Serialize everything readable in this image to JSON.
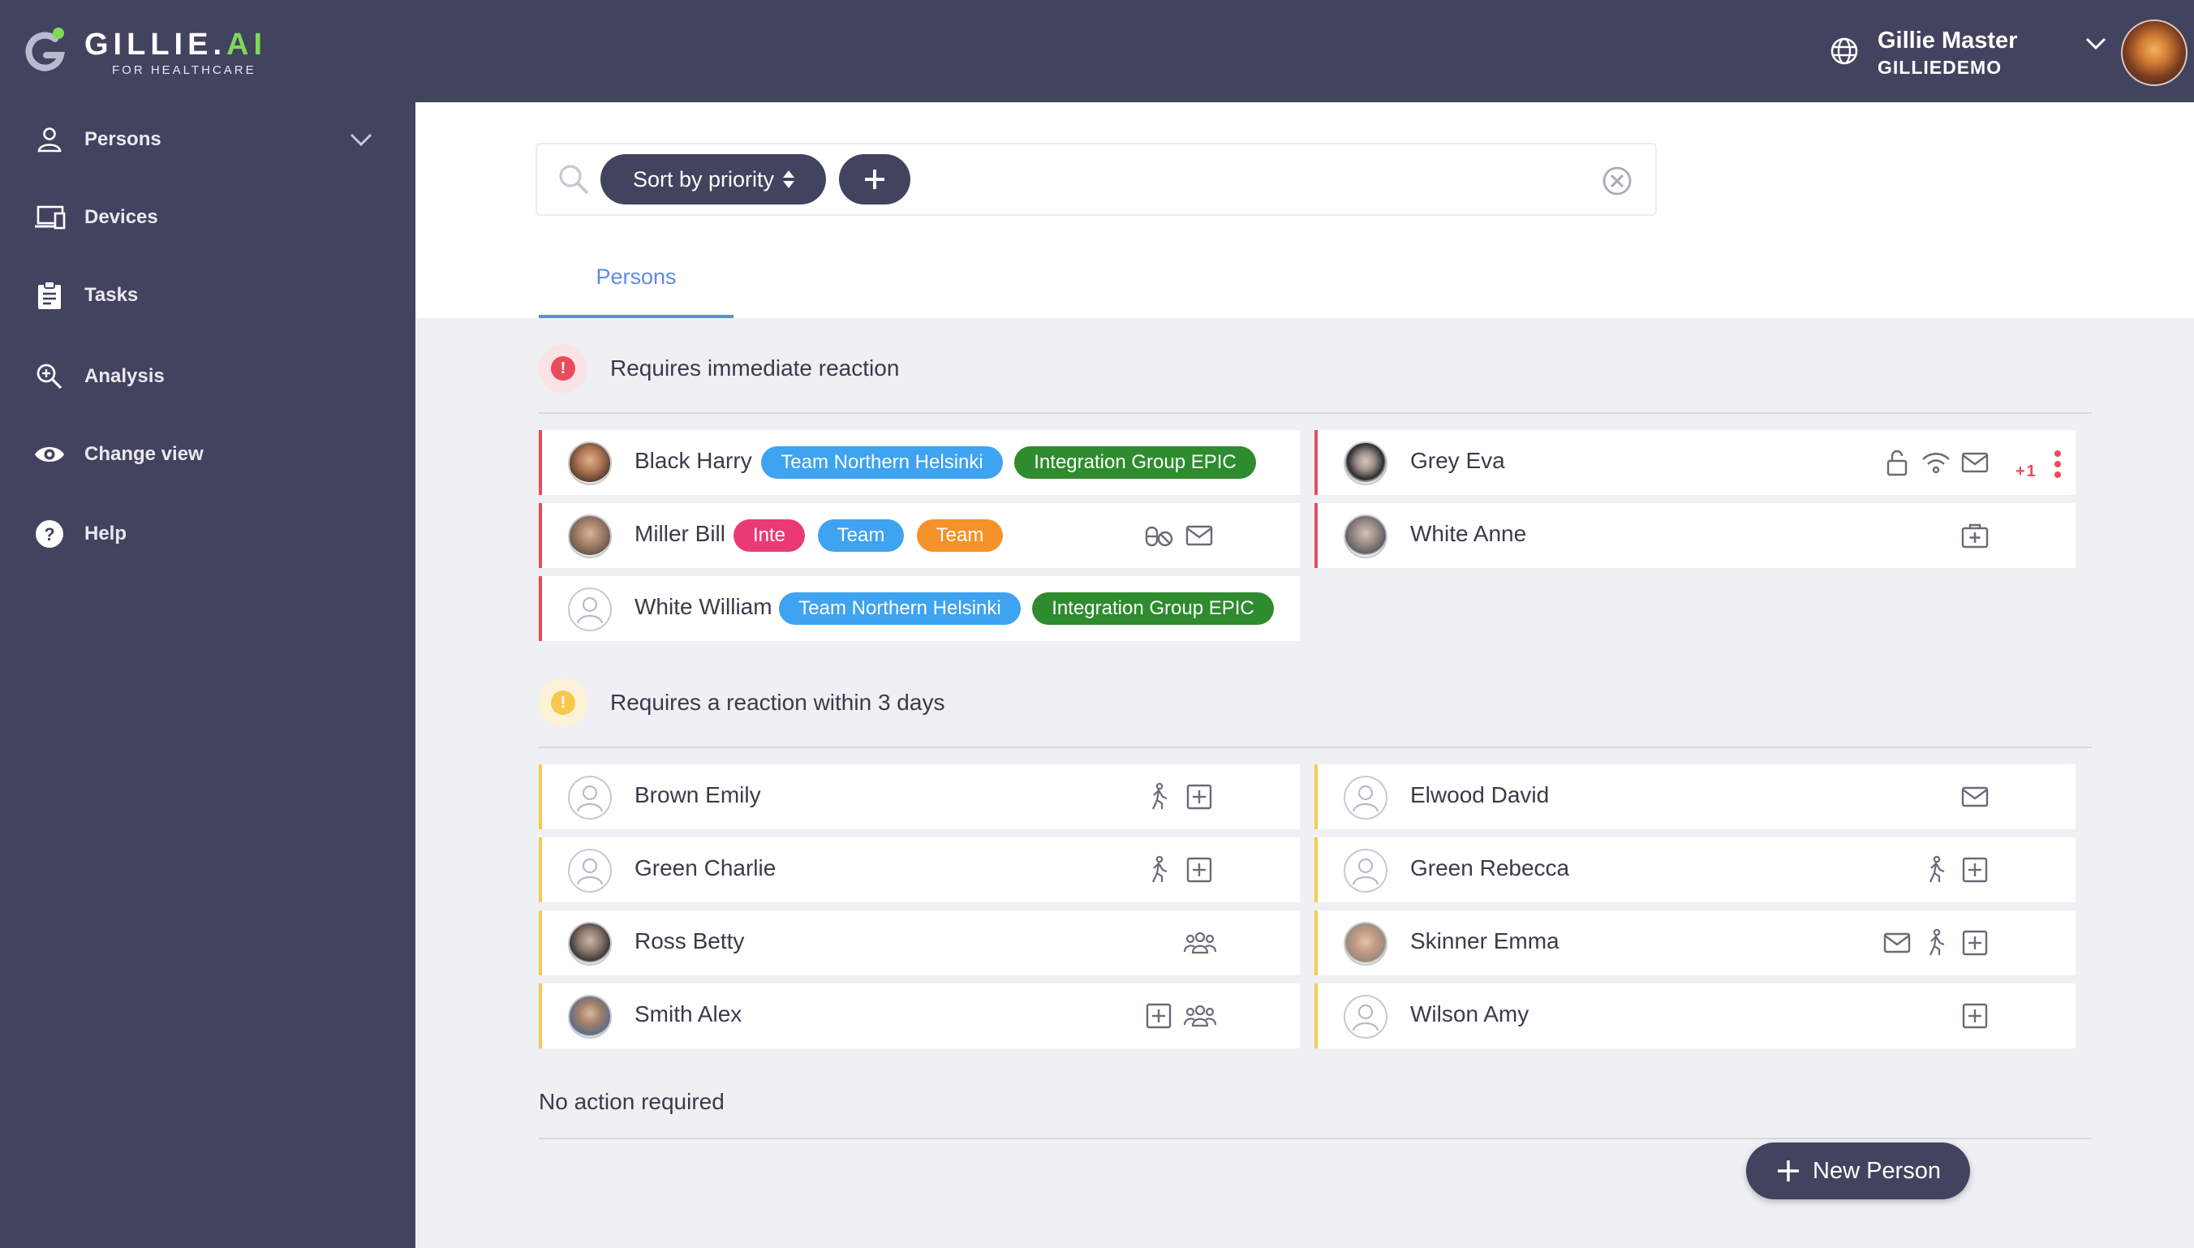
{
  "brand": {
    "word_main": "GILLIE.",
    "word_accent": "AI",
    "subtitle": "FOR HEALTHCARE"
  },
  "user": {
    "name": "Gillie Master",
    "org": "GILLIEDEMO"
  },
  "sidebar": {
    "items": [
      {
        "label": "Persons",
        "icon": "person-icon"
      },
      {
        "label": "Devices",
        "icon": "devices-icon"
      },
      {
        "label": "Tasks",
        "icon": "clipboard-icon"
      },
      {
        "label": "Analysis",
        "icon": "magnifier-icon"
      },
      {
        "label": "Change view",
        "icon": "eye-icon"
      },
      {
        "label": "Help",
        "icon": "help-icon"
      }
    ]
  },
  "search": {
    "sort_label": "Sort by priority"
  },
  "tabs": [
    {
      "label": "Persons",
      "active": true
    }
  ],
  "sections": [
    {
      "title": "Requires immediate reaction",
      "badge": "!",
      "color": "#e94b5d",
      "left": [
        {
          "name": "Black Harry",
          "tags": [
            "Team Northern Helsinki",
            "Integration Group EPIC"
          ]
        },
        {
          "name": "Miller Bill",
          "tags": [
            "Inte",
            "Team",
            "Team"
          ],
          "icons": [
            "pills-icon",
            "mail-icon"
          ]
        },
        {
          "name": "White William",
          "tags": [
            "Team Northern Helsinki",
            "Integration Group EPIC"
          ]
        }
      ],
      "right": [
        {
          "name": "Grey Eva",
          "icons": [
            "lock-icon",
            "wifi-icon",
            "mail-icon"
          ],
          "more": "+1"
        },
        {
          "name": "White Anne",
          "icons": [
            "medical-kit-icon"
          ]
        }
      ]
    },
    {
      "title": "Requires a reaction within 3 days",
      "badge": "!",
      "color": "#f8c94f",
      "left": [
        {
          "name": "Brown Emily",
          "icons": [
            "walking-icon",
            "plus-box-icon"
          ]
        },
        {
          "name": "Green Charlie",
          "icons": [
            "walking-icon",
            "plus-box-icon"
          ]
        },
        {
          "name": "Ross Betty",
          "icons": [
            "group-icon"
          ]
        },
        {
          "name": "Smith Alex",
          "icons": [
            "plus-box-icon",
            "group-icon"
          ]
        }
      ],
      "right": [
        {
          "name": "Elwood David",
          "icons": [
            "mail-icon"
          ]
        },
        {
          "name": "Green Rebecca",
          "icons": [
            "walking-icon",
            "plus-box-icon"
          ]
        },
        {
          "name": "Skinner Emma",
          "icons": [
            "mail-icon",
            "walking-icon",
            "plus-box-icon"
          ]
        },
        {
          "name": "Wilson Amy",
          "icons": [
            "plus-box-icon"
          ]
        }
      ]
    },
    {
      "title": "No action required"
    }
  ],
  "tag_colors": {
    "team_blue": "#3ea3f0",
    "group_green": "#2e8b2e",
    "pink": "#ea3a76",
    "orange": "#f5922a"
  },
  "new_person_label": "New Person"
}
